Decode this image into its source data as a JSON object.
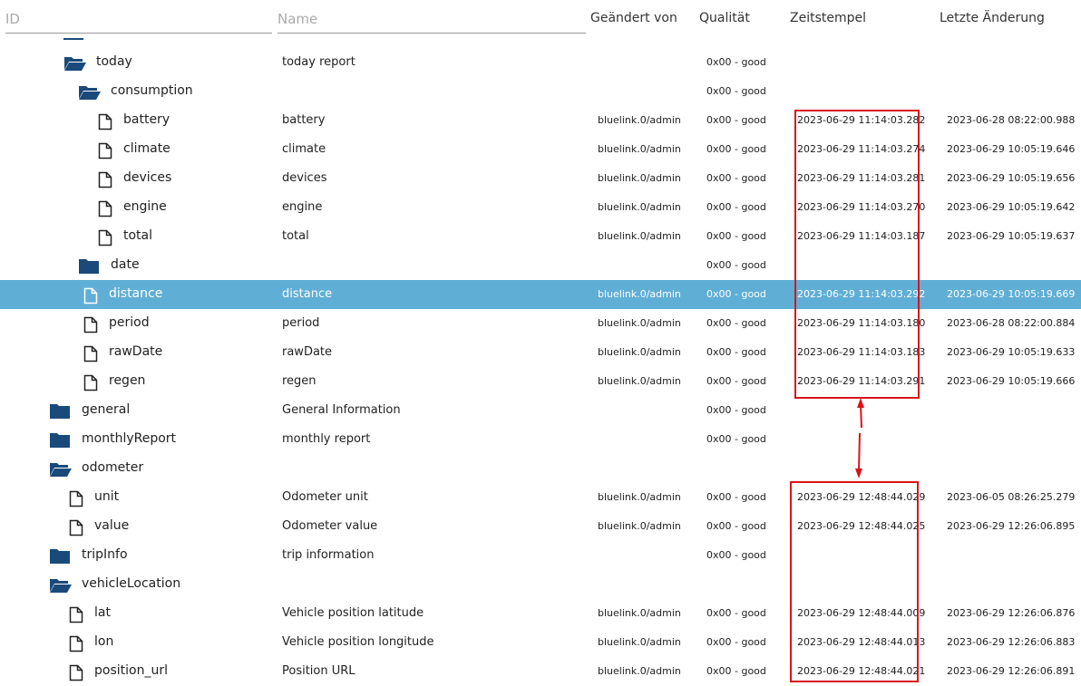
{
  "header": {
    "id_placeholder": "ID",
    "name_placeholder": "Name",
    "changed_by": "Geändert von",
    "quality": "Qualität",
    "timestamp": "Zeitstempel",
    "last_change": "Letzte Änderung"
  },
  "colors": {
    "folder": "#1a4a7a",
    "selected": "#5faed6",
    "highlight": "#d9141b"
  },
  "rows": [
    {
      "id": "today",
      "type": "folder-open",
      "level": 1,
      "name": "today report",
      "from": "",
      "q": "0x00 - good",
      "ts": "",
      "lc": ""
    },
    {
      "id": "consumption",
      "type": "folder-open",
      "level": 2,
      "name": "",
      "from": "",
      "q": "0x00 - good",
      "ts": "",
      "lc": ""
    },
    {
      "id": "battery",
      "type": "file",
      "level": 3,
      "name": "battery",
      "from": "bluelink.0/admin",
      "q": "0x00 - good",
      "ts": "2023-06-29 11:14:03.282",
      "lc": "2023-06-28 08:22:00.988"
    },
    {
      "id": "climate",
      "type": "file",
      "level": 3,
      "name": "climate",
      "from": "bluelink.0/admin",
      "q": "0x00 - good",
      "ts": "2023-06-29 11:14:03.274",
      "lc": "2023-06-29 10:05:19.646"
    },
    {
      "id": "devices",
      "type": "file",
      "level": 3,
      "name": "devices",
      "from": "bluelink.0/admin",
      "q": "0x00 - good",
      "ts": "2023-06-29 11:14:03.281",
      "lc": "2023-06-29 10:05:19.656"
    },
    {
      "id": "engine",
      "type": "file",
      "level": 3,
      "name": "engine",
      "from": "bluelink.0/admin",
      "q": "0x00 - good",
      "ts": "2023-06-29 11:14:03.270",
      "lc": "2023-06-29 10:05:19.642"
    },
    {
      "id": "total",
      "type": "file",
      "level": 3,
      "name": "total",
      "from": "bluelink.0/admin",
      "q": "0x00 - good",
      "ts": "2023-06-29 11:14:03.187",
      "lc": "2023-06-29 10:05:19.637"
    },
    {
      "id": "date",
      "type": "folder",
      "level": 2,
      "name": "",
      "from": "",
      "q": "0x00 - good",
      "ts": "",
      "lc": ""
    },
    {
      "id": "distance",
      "type": "file",
      "level": 2,
      "name": "distance",
      "from": "bluelink.0/admin",
      "q": "0x00 - good",
      "ts": "2023-06-29 11:14:03.292",
      "lc": "2023-06-29 10:05:19.669",
      "selected": true
    },
    {
      "id": "period",
      "type": "file",
      "level": 2,
      "name": "period",
      "from": "bluelink.0/admin",
      "q": "0x00 - good",
      "ts": "2023-06-29 11:14:03.180",
      "lc": "2023-06-28 08:22:00.884"
    },
    {
      "id": "rawDate",
      "type": "file",
      "level": 2,
      "name": "rawDate",
      "from": "bluelink.0/admin",
      "q": "0x00 - good",
      "ts": "2023-06-29 11:14:03.183",
      "lc": "2023-06-29 10:05:19.633"
    },
    {
      "id": "regen",
      "type": "file",
      "level": 2,
      "name": "regen",
      "from": "bluelink.0/admin",
      "q": "0x00 - good",
      "ts": "2023-06-29 11:14:03.291",
      "lc": "2023-06-29 10:05:19.666"
    },
    {
      "id": "general",
      "type": "folder",
      "level": 0,
      "name": "General Information",
      "from": "",
      "q": "0x00 - good",
      "ts": "",
      "lc": ""
    },
    {
      "id": "monthlyReport",
      "type": "folder",
      "level": 0,
      "name": "monthly report",
      "from": "",
      "q": "0x00 - good",
      "ts": "",
      "lc": ""
    },
    {
      "id": "odometer",
      "type": "folder-open",
      "level": 0,
      "name": "",
      "from": "",
      "q": "",
      "ts": "",
      "lc": ""
    },
    {
      "id": "unit",
      "type": "file",
      "level": 1,
      "name": "Odometer unit",
      "from": "bluelink.0/admin",
      "q": "0x00 - good",
      "ts": "2023-06-29 12:48:44.029",
      "lc": "2023-06-05 08:26:25.279"
    },
    {
      "id": "value",
      "type": "file",
      "level": 1,
      "name": "Odometer value",
      "from": "bluelink.0/admin",
      "q": "0x00 - good",
      "ts": "2023-06-29 12:48:44.025",
      "lc": "2023-06-29 12:26:06.895"
    },
    {
      "id": "tripInfo",
      "type": "folder",
      "level": 0,
      "name": "trip information",
      "from": "",
      "q": "0x00 - good",
      "ts": "",
      "lc": ""
    },
    {
      "id": "vehicleLocation",
      "type": "folder-open",
      "level": 0,
      "name": "",
      "from": "",
      "q": "",
      "ts": "",
      "lc": ""
    },
    {
      "id": "lat",
      "type": "file",
      "level": 1,
      "name": "Vehicle position latitude",
      "from": "bluelink.0/admin",
      "q": "0x00 - good",
      "ts": "2023-06-29 12:48:44.009",
      "lc": "2023-06-29 12:26:06.876"
    },
    {
      "id": "lon",
      "type": "file",
      "level": 1,
      "name": "Vehicle position longitude",
      "from": "bluelink.0/admin",
      "q": "0x00 - good",
      "ts": "2023-06-29 12:48:44.013",
      "lc": "2023-06-29 12:26:06.883"
    },
    {
      "id": "position_url",
      "type": "file",
      "level": 1,
      "name": "Position URL",
      "from": "bluelink.0/admin",
      "q": "0x00 - good",
      "ts": "2023-06-29 12:48:44.021",
      "lc": "2023-06-29 12:26:06.891"
    }
  ]
}
